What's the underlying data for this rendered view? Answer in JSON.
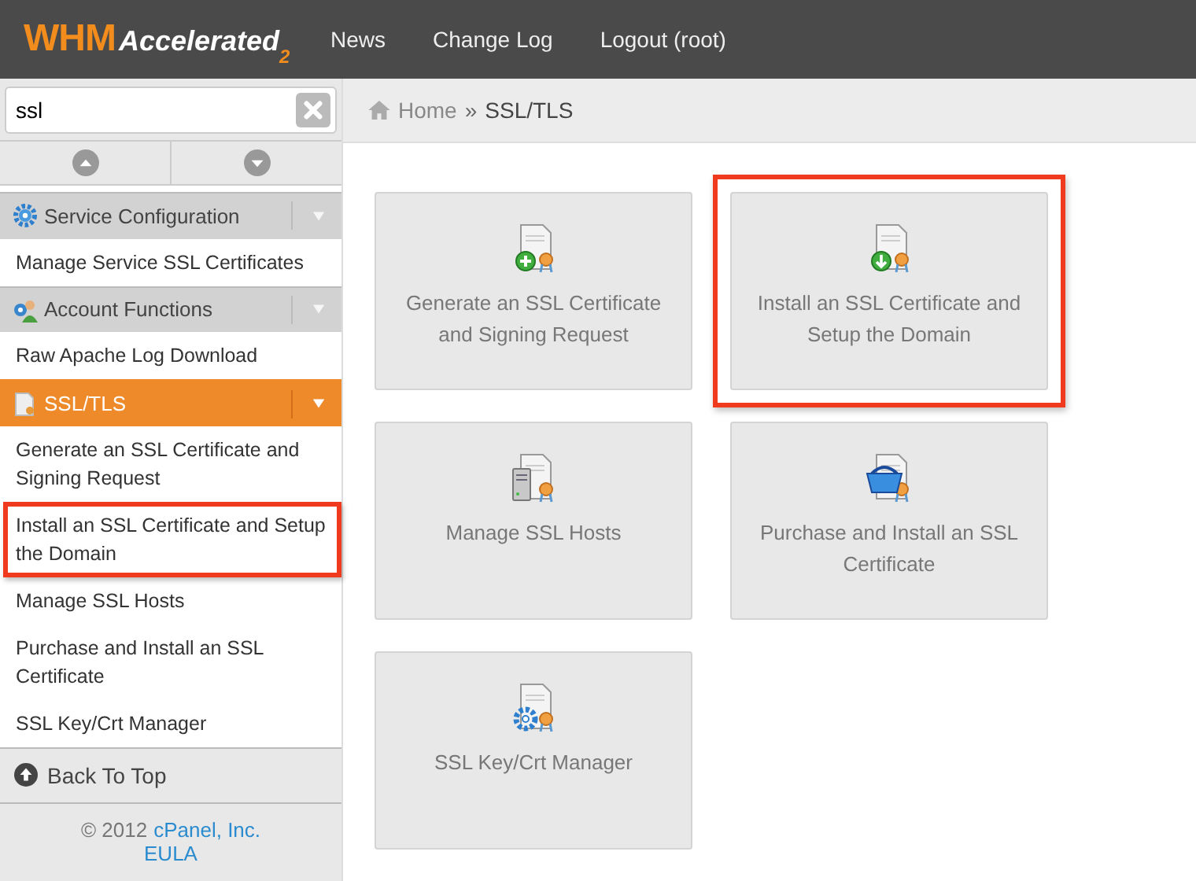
{
  "topbar": {
    "logo": {
      "brand": "WHM",
      "product": "Accelerated",
      "version": "2"
    },
    "nav": [
      "News",
      "Change Log",
      "Logout (root)"
    ]
  },
  "sidebar": {
    "search": {
      "value": "ssl"
    },
    "sections": [
      {
        "title": "Service Configuration",
        "kind": "gear",
        "selected": false,
        "items": [
          {
            "label": "Manage Service SSL Certificates",
            "highlighted": false
          }
        ]
      },
      {
        "title": "Account Functions",
        "kind": "user",
        "selected": false,
        "items": [
          {
            "label": "Raw Apache Log Download",
            "highlighted": false
          }
        ]
      },
      {
        "title": "SSL/TLS",
        "kind": "document",
        "selected": true,
        "items": [
          {
            "label": "Generate an SSL Certificate and Signing Request",
            "highlighted": false
          },
          {
            "label": "Install an SSL Certificate and Setup the Domain",
            "highlighted": true
          },
          {
            "label": "Manage SSL Hosts",
            "highlighted": false
          },
          {
            "label": "Purchase and Install an SSL Certificate",
            "highlighted": false
          },
          {
            "label": "SSL Key/Crt Manager",
            "highlighted": false
          }
        ]
      }
    ],
    "back_to_top": "Back To Top",
    "footer": {
      "copyright": "© 2012",
      "company": "cPanel, Inc.",
      "eula": "EULA"
    }
  },
  "breadcrumb": {
    "items": [
      "Home",
      "SSL/TLS"
    ],
    "separator": "»"
  },
  "tiles": [
    {
      "label": "Generate an SSL Certificate and Signing Request",
      "kind": "plus",
      "highlighted": false
    },
    {
      "label": "Install an SSL Certificate and Setup the Domain",
      "kind": "download",
      "highlighted": true
    },
    {
      "label": "Manage SSL Hosts",
      "kind": "server",
      "highlighted": false
    },
    {
      "label": "Purchase and Install an SSL Certificate",
      "kind": "basket",
      "highlighted": false
    },
    {
      "label": "SSL Key/Crt Manager",
      "kind": "gear",
      "highlighted": false
    }
  ]
}
